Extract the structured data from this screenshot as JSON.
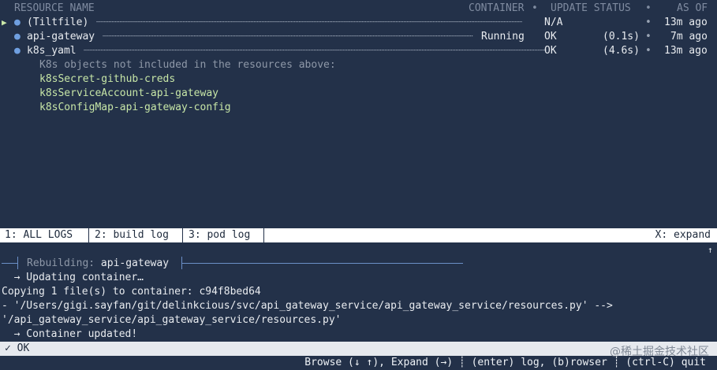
{
  "header": {
    "resource_name": "RESOURCE NAME",
    "container": "CONTAINER",
    "update_status": "UPDATE STATUS",
    "as_of": "AS OF",
    "dot_sep": "•"
  },
  "resources": [
    {
      "marker": "▶",
      "bullet": "●",
      "name": "(Tiltfile)",
      "container": "",
      "status": "N/A",
      "duration": "",
      "sep": "•",
      "as_of": "13m ago"
    },
    {
      "marker": "",
      "bullet": "●",
      "name": "api-gateway",
      "container": "Running",
      "status": "OK",
      "duration": "(0.1s)",
      "sep": "•",
      "as_of": "7m ago"
    },
    {
      "marker": "",
      "bullet": "●",
      "name": "k8s_yaml",
      "container": "",
      "status": "OK",
      "duration": "(4.6s)",
      "sep": "•",
      "as_of": "13m ago"
    }
  ],
  "k8s_note": "K8s objects not included in the resources above:",
  "k8s_objects": [
    "k8sSecret-github-creds",
    "k8sServiceAccount-api-gateway",
    "k8sConfigMap-api-gateway-config"
  ],
  "tabs": [
    "1: ALL LOGS",
    "2: build log",
    "3: pod log"
  ],
  "expand_hint": "X: expand",
  "up_arrow": "↑",
  "log": {
    "rebuild_prefix": "Rebuilding: ",
    "rebuild_target": "api-gateway",
    "lines": [
      "  → Updating container…",
      "Copying 1 file(s) to container: c94f8bed64",
      "- '/Users/gigi.sayfan/git/delinkcious/svc/api_gateway_service/api_gateway_service/resources.py' -->",
      "'/api_gateway_service/api_gateway_service/resources.py'",
      "  → Container updated!"
    ],
    "ok_line": "✓ OK"
  },
  "footer": "Browse (↓ ↑), Expand (→) ┊ (enter) log, (b)rowser ┊ (ctrl-C) quit",
  "watermark": "@稀土掘金技术社区",
  "colors": {
    "background": "#233149",
    "accent": "#6b8fc7",
    "bullet": "#6f9fe0"
  }
}
